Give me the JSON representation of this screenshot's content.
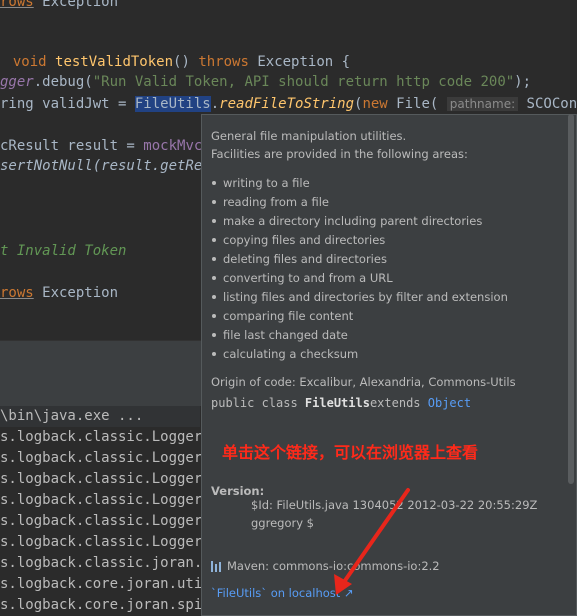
{
  "editor": {
    "l1_kw": "rows",
    "l1_rest": " Exception",
    "l2_void": "void ",
    "l2_method": "testValidToken",
    "l2_rest": "() ",
    "l2_throws": "throws",
    "l2_exc": " Exception {",
    "l3_logger": "gger",
    "l3_debug": ".debug(",
    "l3_str": "\"Run Valid Token, API should return http code 200\"",
    "l3_end": ");",
    "l4_pre": "ring validJwt = ",
    "l4_fileutils": "FileUtils",
    "l4_dot": ".",
    "l4_method": "readFileToString",
    "l4_paren": "(",
    "l4_new": "new",
    "l4_file": " File( ",
    "l4_hint": "pathname:",
    "l4_const": " SCOConstant",
    "l5_pre": "cResult result = ",
    "l5_mock": "mockMvc",
    "l5_dot": ".",
    "l6_text": "sertNotNull(result.getRes",
    "l7_comment": "t Invalid Token",
    "l8_kw": "rows",
    "l8_rest": " Exception"
  },
  "console": {
    "lines": [
      "\\bin\\java.exe ...",
      "s.logback.classic.LoggerCo",
      "s.logback.classic.LoggerCo",
      "s.logback.classic.LoggerCo",
      "s.logback.classic.LoggerCo",
      "s.logback.classic.LoggerCo",
      "s.logback.classic.LoggerCo",
      "s.logback.classic.joran.ac",
      "s.logback.core.joran.util.",
      "s.logback.core.joran.spi.C"
    ]
  },
  "popup": {
    "desc1": "General file manipulation utilities.",
    "desc2": "Facilities are provided in the following areas:",
    "bullets": [
      "writing to a file",
      "reading from a file",
      "make a directory including parent directories",
      "copying files and directories",
      "deleting files and directories",
      "converting to and from a URL",
      "listing files and directories by filter and extension",
      "comparing file content",
      "file last changed date",
      "calculating a checksum"
    ],
    "origin": "Origin of code: Excalibur, Alexandria, Commons-Utils",
    "decl_prefix": "public class ",
    "decl_name": "FileUtils",
    "decl_extends": "extends ",
    "decl_super": "Object",
    "version_label": "Version:",
    "version_line1": "$Id: FileUtils.java 1304052 2012-03-22 20:55:29Z",
    "version_line2": "ggregory $",
    "maven": "Maven: commons-io:commons-io:2.2",
    "external_link": "`FileUtils` on localhost ↗"
  },
  "annotation": "单击这个链接，可以在浏览器上查看",
  "colors": {
    "keyword": "#cc7832",
    "method": "#ffc66d",
    "string": "#6a8759",
    "link": "#589df6",
    "annotation": "#ff2a1a"
  }
}
